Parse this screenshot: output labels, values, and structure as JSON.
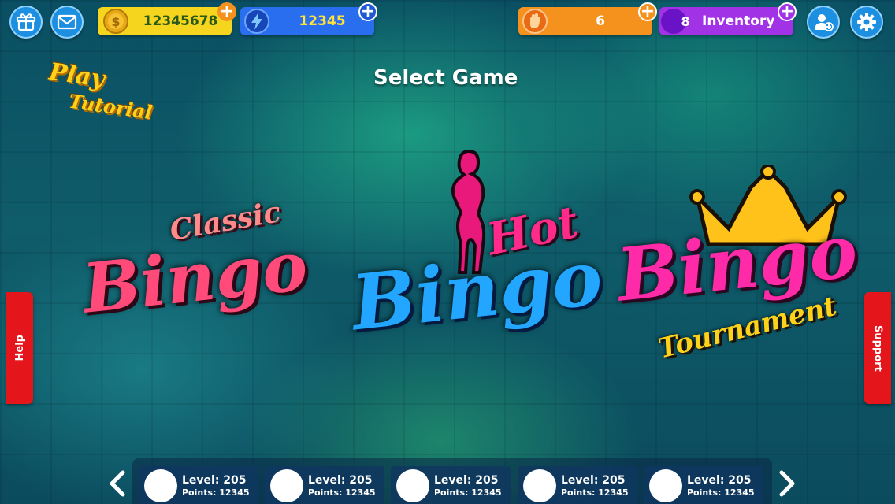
{
  "header": {
    "coins": {
      "value": "12345678",
      "icon": "coin-icon"
    },
    "energy": {
      "value": "12345",
      "icon": "lightning-icon"
    },
    "powerups": {
      "value": "6",
      "icon": "hand-icon"
    },
    "inventory": {
      "count": "8",
      "label": "Inventory"
    },
    "icons": [
      "gift-icon",
      "mail-icon",
      "add-friend-icon",
      "gear-icon"
    ]
  },
  "tutorial": {
    "line1": "Play",
    "line2": "Tutorial"
  },
  "title": "Select Game",
  "games": [
    {
      "small": "Classic",
      "big": "Bingo"
    },
    {
      "small": "Hot",
      "big": "Bingo"
    },
    {
      "small": "Tournament",
      "big": "Bingo"
    }
  ],
  "side": {
    "help": "Help",
    "support": "Support"
  },
  "players": [
    {
      "level": "Level: 205",
      "points": "Points: 12345"
    },
    {
      "level": "Level: 205",
      "points": "Points: 12345"
    },
    {
      "level": "Level: 205",
      "points": "Points: 12345"
    },
    {
      "level": "Level: 205",
      "points": "Points: 12345"
    },
    {
      "level": "Level: 205",
      "points": "Points: 12345"
    }
  ],
  "colors": {
    "coin_pill": "#f5d51e",
    "energy_pill": "#2a6ef0",
    "power_pill": "#f5921e",
    "inventory_pill": "#a132e6",
    "plus_green": "#55d628",
    "help_tab": "#e5161b"
  }
}
